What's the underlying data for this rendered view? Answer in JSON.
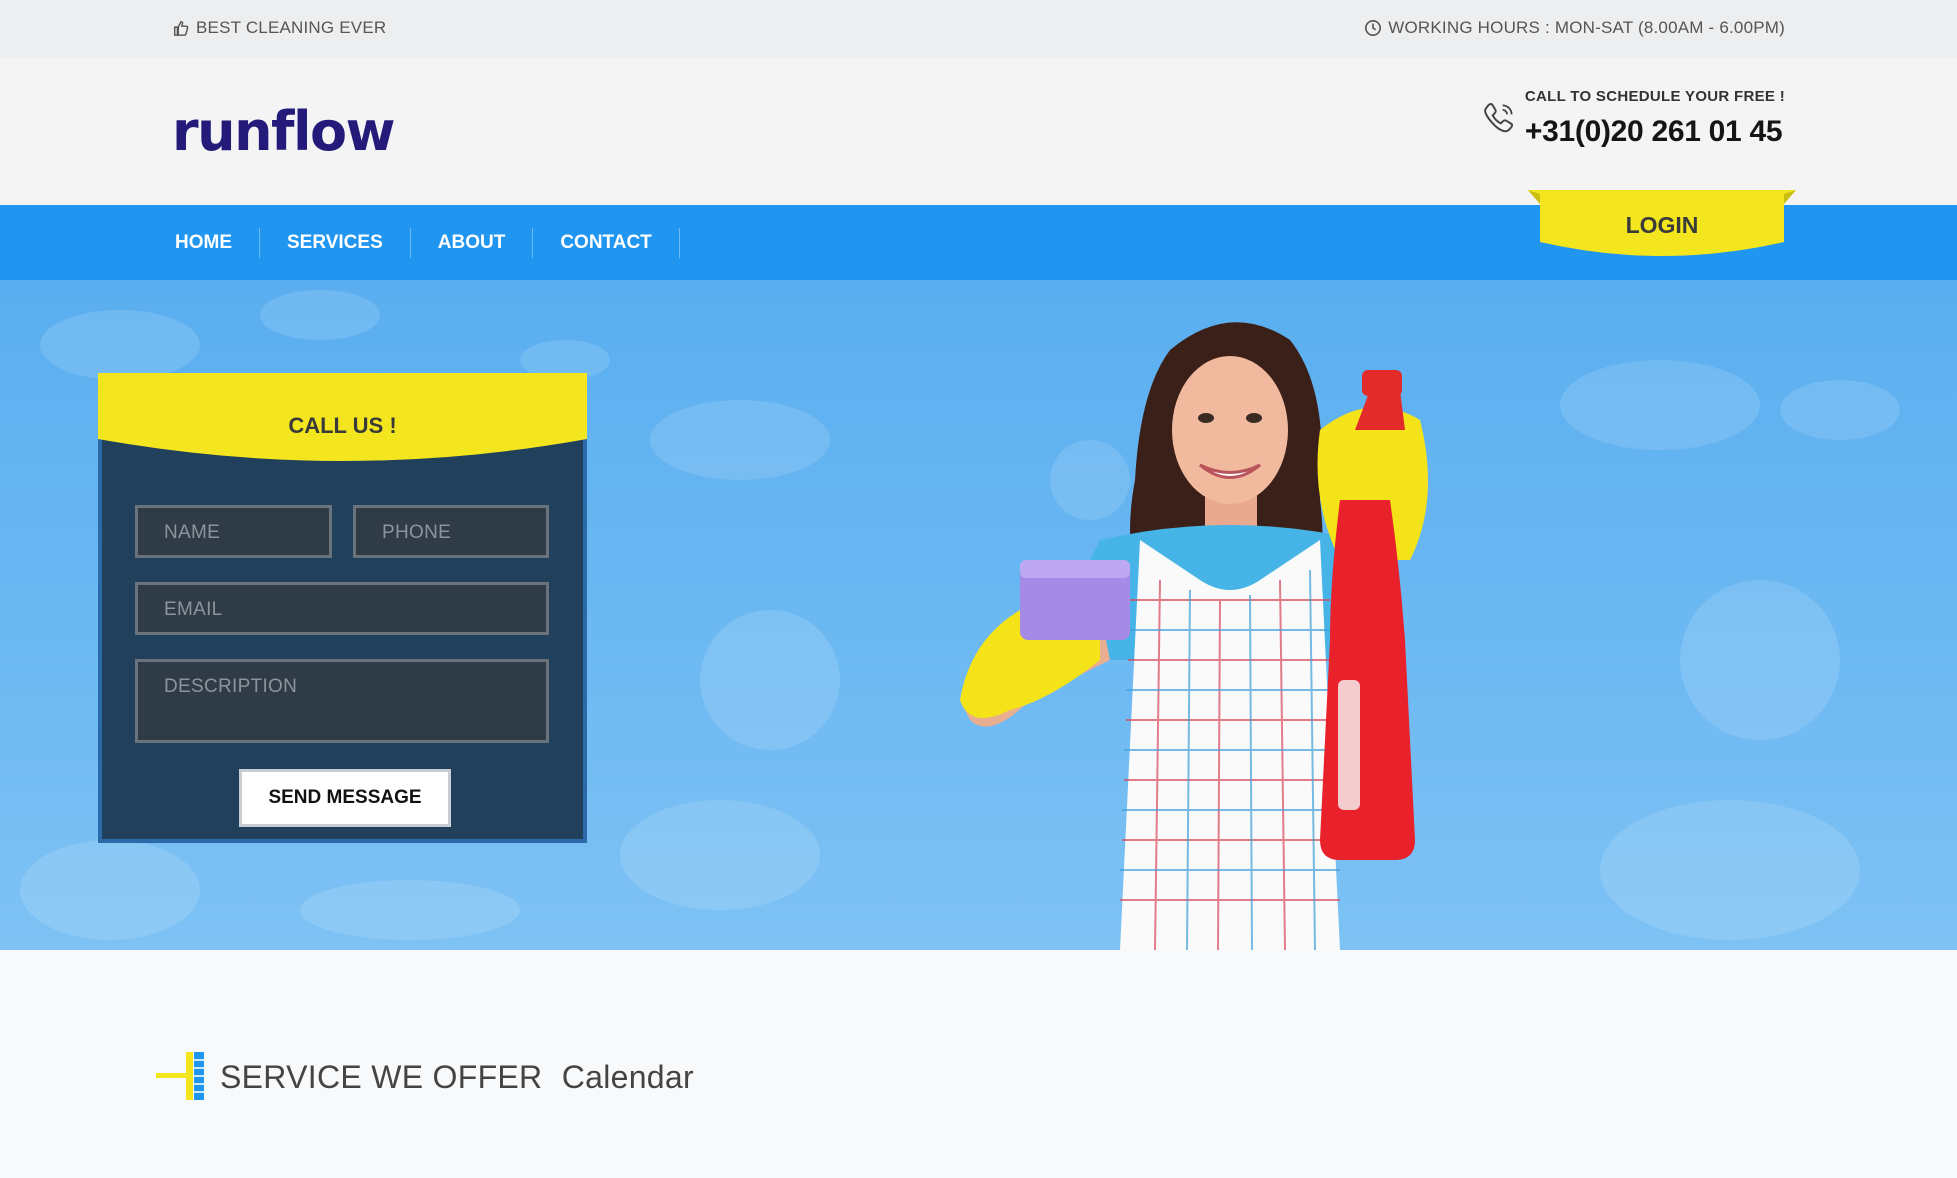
{
  "topbar": {
    "tagline": "BEST CLEANING EVER",
    "tagline_icon": "thumbs-up-icon",
    "hours": "WORKING HOURS : MON-SAT (8.00AM - 6.00PM)",
    "hours_icon": "clock-icon"
  },
  "header": {
    "logo": "runflow",
    "call_label": "CALL TO SCHEDULE YOUR FREE !",
    "phone": "+31(0)20 261 01 45",
    "phone_icon": "phone-icon"
  },
  "nav": {
    "items": [
      {
        "label": "HOME"
      },
      {
        "label": "SERVICES"
      },
      {
        "label": "ABOUT"
      },
      {
        "label": "CONTACT"
      }
    ],
    "login": "LOGIN"
  },
  "form": {
    "title": "CALL US !",
    "name_placeholder": "NAME",
    "phone_placeholder": "PHONE",
    "email_placeholder": "EMAIL",
    "description_placeholder": "DESCRIPTION",
    "submit": "SEND MESSAGE"
  },
  "section": {
    "title": "SERVICE WE OFFER",
    "subtitle": "Calendar"
  },
  "colors": {
    "nav": "#2196f0",
    "accent_yellow": "#f3e61e",
    "logo": "#241a7a",
    "form_bg": "#21405c"
  }
}
